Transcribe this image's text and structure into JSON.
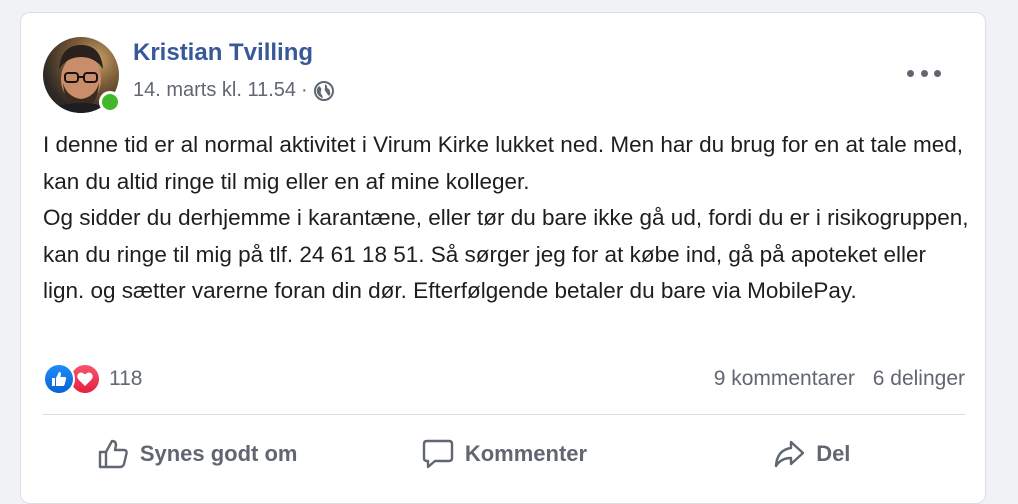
{
  "post": {
    "author": "Kristian Tvilling",
    "timestamp": "14. marts kl. 11.54",
    "separator": "·",
    "privacy_icon": "globe-icon",
    "body_lines": [
      "I denne tid er al normal aktivitet i Virum Kirke lukket ned. Men har du brug for en at tale med, kan du altid ringe til mig eller en af mine kolleger.",
      "Og sidder du derhjemme i karantæne, eller tør du bare ikke gå ud, fordi du er i risikogruppen, kan du ringe til mig på tlf. 24 61 18 51. Så sørger jeg for at købe ind, gå på apoteket eller lign. og sætter varerne foran din dør. Efterfølgende betaler du bare via MobilePay."
    ]
  },
  "stats": {
    "reactions_count": "118",
    "comments": "9 kommentarer",
    "shares": "6 delinger"
  },
  "actions": {
    "like": "Synes godt om",
    "comment": "Kommenter",
    "share": "Del"
  },
  "colors": {
    "name": "#385898",
    "text": "#1c1e21",
    "secondary": "#606770",
    "online": "#42b72a",
    "like": "#1877f2",
    "love": "#f33e58"
  }
}
